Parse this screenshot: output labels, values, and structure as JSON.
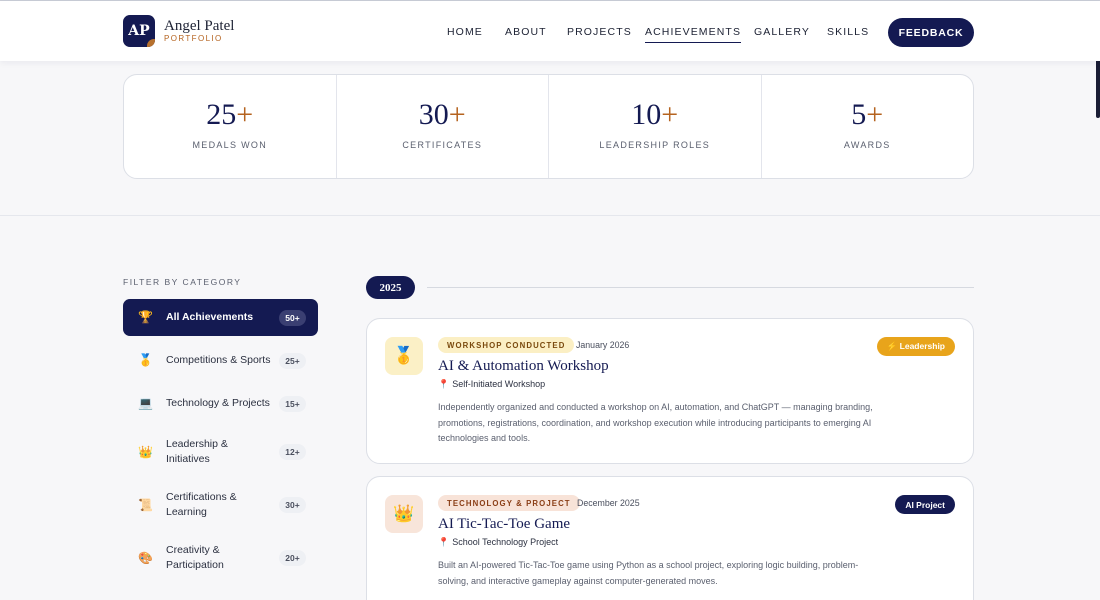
{
  "header": {
    "logo_initials": "AP",
    "brand_name": "Angel Patel",
    "brand_sub": "PORTFOLIO",
    "nav": [
      "HOME",
      "ABOUT",
      "PROJECTS",
      "ACHIEVEMENTS",
      "GALLERY",
      "SKILLS"
    ],
    "active_nav": "ACHIEVEMENTS",
    "feedback_label": "FEEDBACK"
  },
  "stats": [
    {
      "value": "25",
      "suffix": "+",
      "label": "MEDALS WON"
    },
    {
      "value": "30",
      "suffix": "+",
      "label": "CERTIFICATES"
    },
    {
      "value": "10",
      "suffix": "+",
      "label": "LEADERSHIP ROLES"
    },
    {
      "value": "5",
      "suffix": "+",
      "label": "AWARDS"
    }
  ],
  "filter": {
    "title": "FILTER BY CATEGORY",
    "items": [
      {
        "icon": "🏆",
        "label": "All Achievements",
        "count": "50+"
      },
      {
        "icon": "🥇",
        "label": "Competitions & Sports",
        "count": "25+"
      },
      {
        "icon": "💻",
        "label": "Technology & Projects",
        "count": "15+"
      },
      {
        "icon": "👑",
        "label": "Leadership &",
        "label2": "Initiatives",
        "count": "12+"
      },
      {
        "icon": "📜",
        "label": "Certifications &",
        "label2": "Learning",
        "count": "30+"
      },
      {
        "icon": "🎨",
        "label": "Creativity &",
        "label2": "Participation",
        "count": "20+"
      }
    ]
  },
  "timeline": {
    "year": "2025",
    "cards": [
      {
        "icon": "🥇",
        "icon_name": "medal-icon",
        "tag": "WORKSHOP CONDUCTED",
        "date": "January 2026",
        "title": "AI & Automation Workshop",
        "location": "Self-Initiated Workshop",
        "description": "Independently organized and conducted a workshop on AI, automation, and ChatGPT — managing branding, promotions, registrations, coordination, and workshop execution while introducing participants to emerging AI technologies and tools.",
        "badge": "⚡ Leadership",
        "badge_color": "#e8a41b"
      },
      {
        "icon": "👑",
        "icon_name": "crown-icon",
        "tag": "TECHNOLOGY & PROJECT",
        "date": "December 2025",
        "title": "AI Tic-Tac-Toe Game",
        "location": "School Technology Project",
        "description": "Built an AI-powered Tic-Tac-Toe game using Python as a school project, exploring logic building, problem-solving, and interactive gameplay against computer-generated moves.",
        "badge": "AI Project",
        "badge_color": "#141a52"
      }
    ]
  },
  "colors": {
    "navy": "#141a52",
    "accent_brown": "#b5631f",
    "leadership_badge": "#e8a41b"
  }
}
